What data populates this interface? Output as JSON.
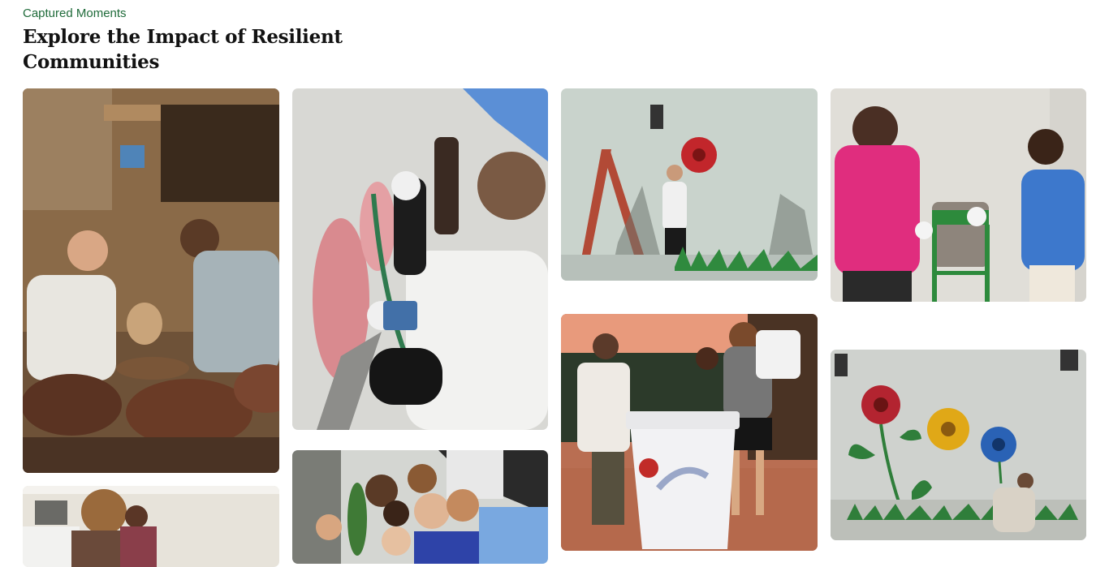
{
  "header": {
    "eyebrow": "Captured Moments",
    "title": "Explore the Impact of Resilient Communities"
  },
  "gallery": {
    "photos": [
      {
        "subject": "pottery workshop with two young men at a wheel"
      },
      {
        "subject": "volunteer painting pink flower on wall"
      },
      {
        "subject": "volunteer posing with painted hands by wall with red flower"
      },
      {
        "subject": "two volunteers painting a green bin stand"
      },
      {
        "subject": "group of volunteers painting a trash bin"
      },
      {
        "subject": "wall mural with three flowers and crouching painter"
      },
      {
        "subject": "volunteers working at a table"
      },
      {
        "subject": "group selfie of smiling volunteers"
      }
    ]
  },
  "colors": {
    "accent_green": "#1f6b3a",
    "title_text": "#121212"
  }
}
